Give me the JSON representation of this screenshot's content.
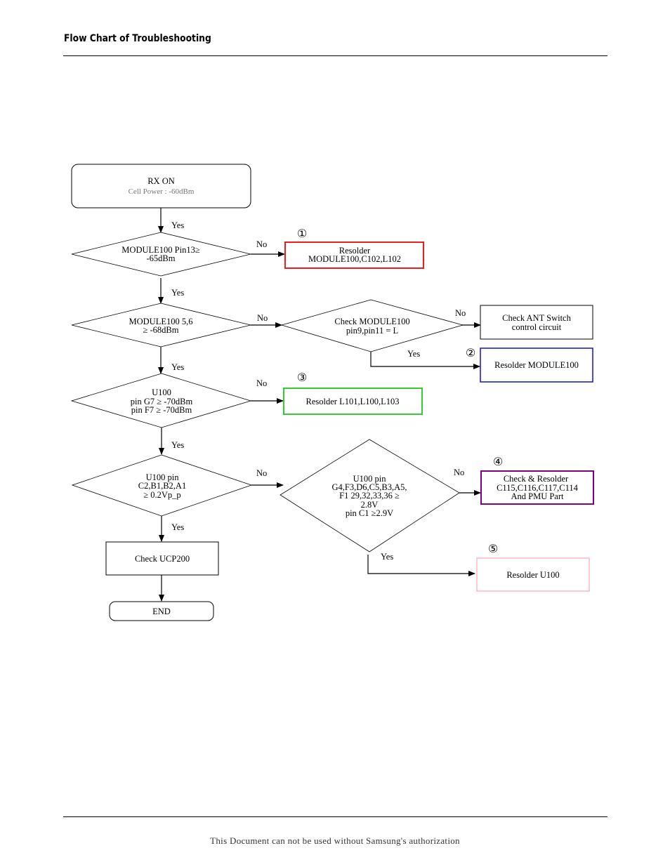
{
  "header": {
    "title": "Flow Chart of Troubleshooting"
  },
  "footer": {
    "text": "This Document can not be used without Samsung's authorization"
  },
  "flowchart": {
    "start": {
      "title": "RX ON",
      "subtitle": "Cell Power : -60dBm"
    },
    "decisions": [
      {
        "id": "d1",
        "lines": [
          "MODULE100 Pin13≥",
          "-65dBm"
        ]
      },
      {
        "id": "d2",
        "lines": [
          "MODULE100 5,6",
          "≥ -68dBm"
        ]
      },
      {
        "id": "d2b",
        "lines": [
          "Check MODULE100",
          "pin9,pin11 = L"
        ]
      },
      {
        "id": "d3",
        "lines": [
          "U100",
          "pin G7 ≥ -70dBm",
          "pin F7 ≥ -70dBm"
        ]
      },
      {
        "id": "d4",
        "lines": [
          "U100 pin",
          "C2,B1,B2,A1",
          "≥ 0.2Vp_p"
        ]
      },
      {
        "id": "d4b",
        "lines": [
          "U100 pin",
          "G4,F3,D6,C5,B3,A5,",
          "F1 29,32,33,36 ≥",
          "2.8V",
          "pin C1 ≥2.9V"
        ]
      }
    ],
    "actions": [
      {
        "id": "a1",
        "badge": "①",
        "color": "#ee1c1c",
        "lines": [
          "Resolder",
          "MODULE100,C102,L102"
        ]
      },
      {
        "id": "a_ant",
        "badge": "",
        "color": "#000000",
        "lines": [
          "Check ANT Switch",
          "control circuit"
        ]
      },
      {
        "id": "a2",
        "badge": "②",
        "color": "#1010cc",
        "lines": [
          "Resolder MODULE100"
        ]
      },
      {
        "id": "a3",
        "badge": "③",
        "color": "#33cc33",
        "lines": [
          "Resolder L101,L100,L103"
        ]
      },
      {
        "id": "a4",
        "badge": "④",
        "color": "#800080",
        "lines": [
          "Check & Resolder",
          "C115,C116,C117,C114",
          "And PMU Part"
        ]
      },
      {
        "id": "a5",
        "badge": "⑤",
        "color": "#ffb6c1",
        "lines": [
          "Resolder U100"
        ]
      },
      {
        "id": "ucp",
        "badge": "",
        "color": "#000000",
        "lines": [
          "Check UCP200"
        ]
      }
    ],
    "end": {
      "label": "END"
    },
    "edge_labels": {
      "yes": "Yes",
      "no": "No"
    }
  }
}
